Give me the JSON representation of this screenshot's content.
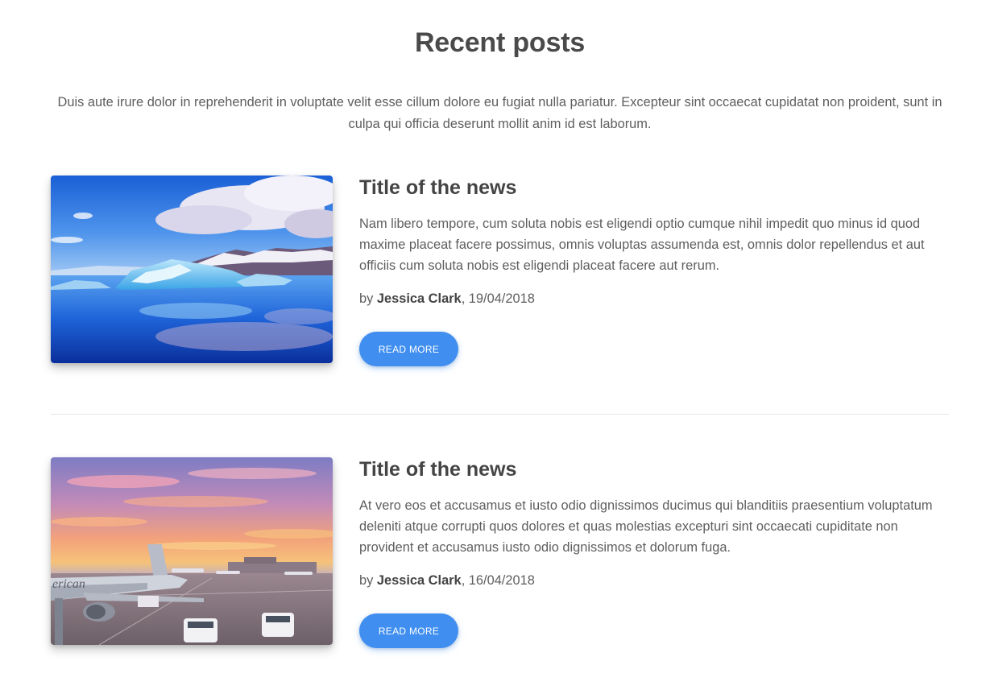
{
  "section": {
    "title": "Recent posts",
    "intro": "Duis aute irure dolor in reprehenderit in voluptate velit esse cillum dolore eu fugiat nulla pariatur. Excepteur sint occaecat cupidatat non proident, sunt in culpa qui officia deserunt mollit anim id est laborum."
  },
  "posts": [
    {
      "title": "Title of the news",
      "excerpt": "Nam libero tempore, cum soluta nobis est eligendi optio cumque nihil impedit quo minus id quod maxime placeat facere possimus, omnis voluptas assumenda est, omnis dolor repellendus et aut officiis cum soluta nobis est eligendi placeat facere aut rerum.",
      "by": "by ",
      "author": "Jessica Clark",
      "date": ", 19/04/2018",
      "button": "READ MORE"
    },
    {
      "title": "Title of the news",
      "excerpt": "At vero eos et accusamus et iusto odio dignissimos ducimus qui blanditiis praesentium voluptatum deleniti atque corrupti quos dolores et quas molestias excepturi sint occaecati cupiditate non provident et accusamus iusto odio dignissimos et dolorum fuga.",
      "by": "by ",
      "author": "Jessica Clark",
      "date": ", 16/04/2018",
      "button": "READ MORE"
    }
  ],
  "theme": {
    "accent": "#3f8ef0",
    "heading": "#444444",
    "text": "#5e5e5e"
  }
}
